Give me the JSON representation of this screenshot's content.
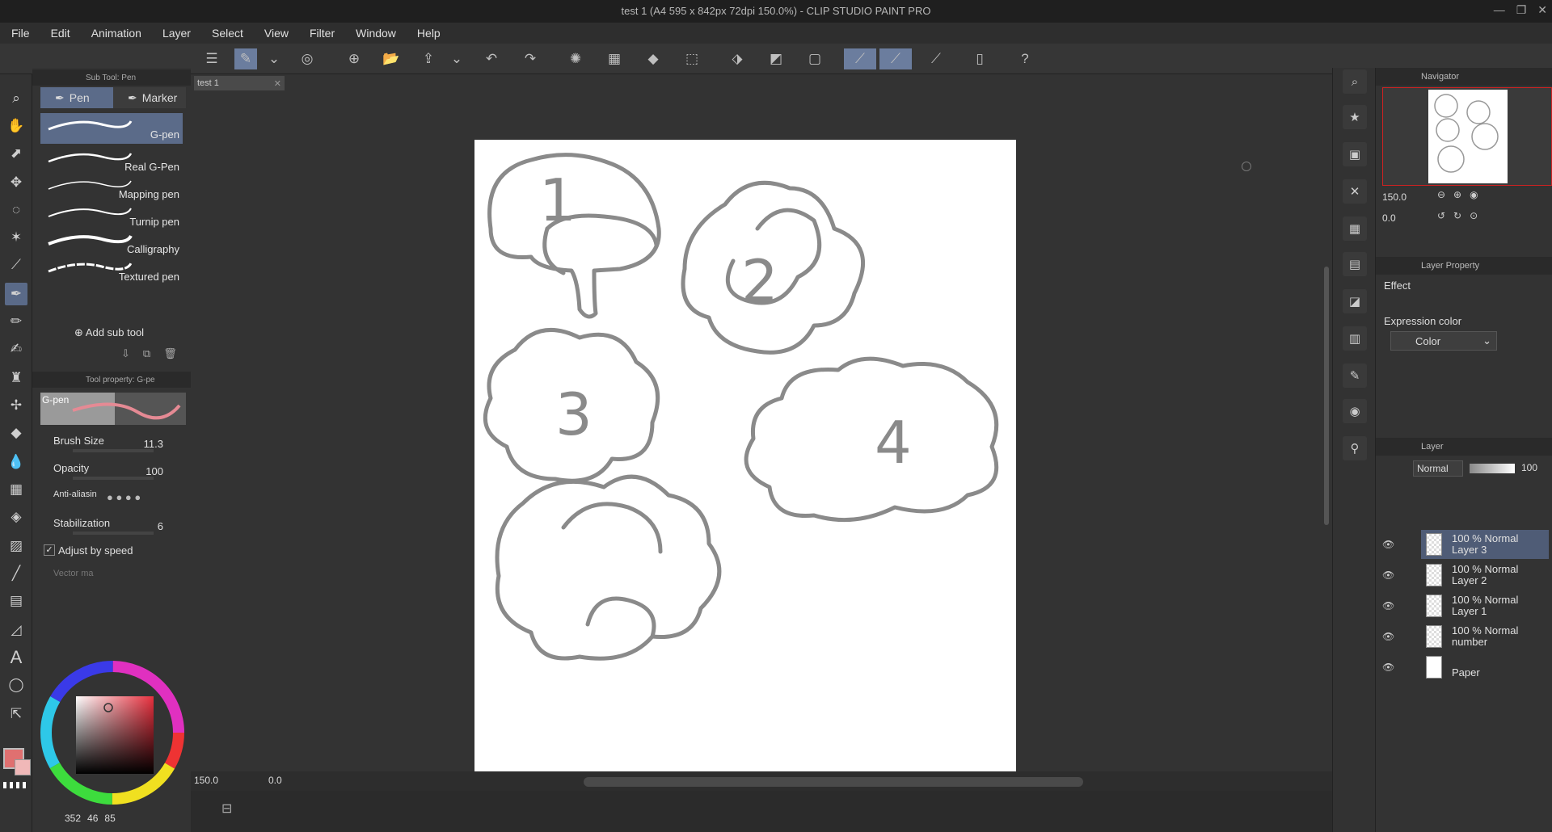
{
  "window": {
    "title": "test 1 (A4 595 x 842px 72dpi 150.0%)  - CLIP STUDIO PAINT PRO"
  },
  "menu": [
    "File",
    "Edit",
    "Animation",
    "Layer",
    "Select",
    "View",
    "Filter",
    "Window",
    "Help"
  ],
  "subtool": {
    "header": "Sub Tool: Pen",
    "tabs": [
      "Pen",
      "Marker"
    ],
    "brushes": [
      "G-pen",
      "Real G-Pen",
      "Mapping pen",
      "Turnip pen",
      "Calligraphy",
      "Textured pen"
    ],
    "add_label": "Add sub tool"
  },
  "toolprop": {
    "header": "Tool property: G-pe",
    "preview_label": "G-pen",
    "brush_size_label": "Brush Size",
    "brush_size_value": "11.3",
    "opacity_label": "Opacity",
    "opacity_value": "100",
    "antialias_label": "Anti-aliasin",
    "stabilization_label": "Stabilization",
    "stabilization_value": "6",
    "adjust_label": "Adjust by speed",
    "vector_label": "Vector ma"
  },
  "color": {
    "main": "#e06f6f",
    "sub": "#f5b5b5",
    "readout": "352  46  85",
    "readout_h": "352",
    "readout_s": "46",
    "readout_v": "85"
  },
  "document": {
    "tab": "test 1"
  },
  "canvas": {
    "numbers": [
      "1",
      "2",
      "3",
      "4"
    ]
  },
  "status": {
    "zoom": "150.0",
    "angle": "0.0"
  },
  "navigator": {
    "header": "Navigator",
    "zoom": "150.0",
    "rotate": "0.0"
  },
  "layer_property": {
    "header": "Layer Property",
    "effect_label": "Effect",
    "expression_label": "Expression color",
    "expression_value": "Color"
  },
  "layers": {
    "header": "Layer",
    "blend": "Normal",
    "opacity": "100",
    "items": [
      {
        "top": "100 % Normal",
        "name": "Layer 3"
      },
      {
        "top": "100 % Normal",
        "name": "Layer 2"
      },
      {
        "top": "100 % Normal",
        "name": "Layer 1"
      },
      {
        "top": "100 % Normal",
        "name": "number"
      },
      {
        "top": "",
        "name": "Paper"
      }
    ]
  },
  "icons": {
    "toolbar": [
      "menu-icon",
      "new-icon",
      "open-icon",
      "save-icon",
      "undo-icon",
      "redo-icon",
      "transform-icon"
    ],
    "tools": [
      "zoom-icon",
      "hand-icon",
      "operation-icon",
      "move-icon",
      "lasso-icon",
      "wand-icon",
      "eyedropper-icon",
      "pen-icon",
      "pencil-icon",
      "brush-icon",
      "airbrush-icon",
      "decoration-icon",
      "eraser-icon",
      "blend-icon",
      "fill-icon",
      "gradient-icon",
      "figure-icon",
      "frame-icon",
      "ruler-icon",
      "text-icon",
      "balloon-icon",
      "correction-icon"
    ]
  }
}
